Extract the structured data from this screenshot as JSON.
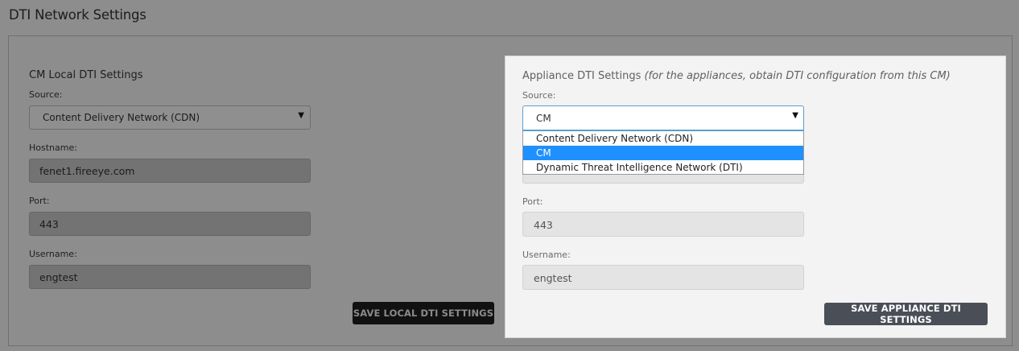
{
  "page": {
    "title": "DTI Network Settings"
  },
  "local": {
    "title": "CM Local DTI Settings",
    "source_label": "Source:",
    "source_value": "Content Delivery Network (CDN)",
    "hostname_label": "Hostname:",
    "hostname_value": "fenet1.fireeye.com",
    "port_label": "Port:",
    "port_value": "443",
    "username_label": "Username:",
    "username_value": "engtest",
    "save_label": "SAVE LOCAL DTI SETTINGS"
  },
  "appliance": {
    "title": "Appliance DTI Settings",
    "title_note": "(for the appliances, obtain DTI configuration from this CM)",
    "source_label": "Source:",
    "source_value": "CM",
    "options": [
      "Content Delivery Network (CDN)",
      "CM",
      "Dynamic Threat Intelligence Network (DTI)"
    ],
    "port_label": "Port:",
    "port_value": "443",
    "username_label": "Username:",
    "username_value": "engtest",
    "save_label": "SAVE APPLIANCE DTI SETTINGS"
  },
  "colors": {
    "overlay": "#8d8d8d",
    "selected_option": "#1e90ff",
    "focus_border": "#5a9fd0",
    "appliance_button": "#4a4f57"
  },
  "icons": {
    "dropdown_arrow": "caret-down-icon"
  }
}
